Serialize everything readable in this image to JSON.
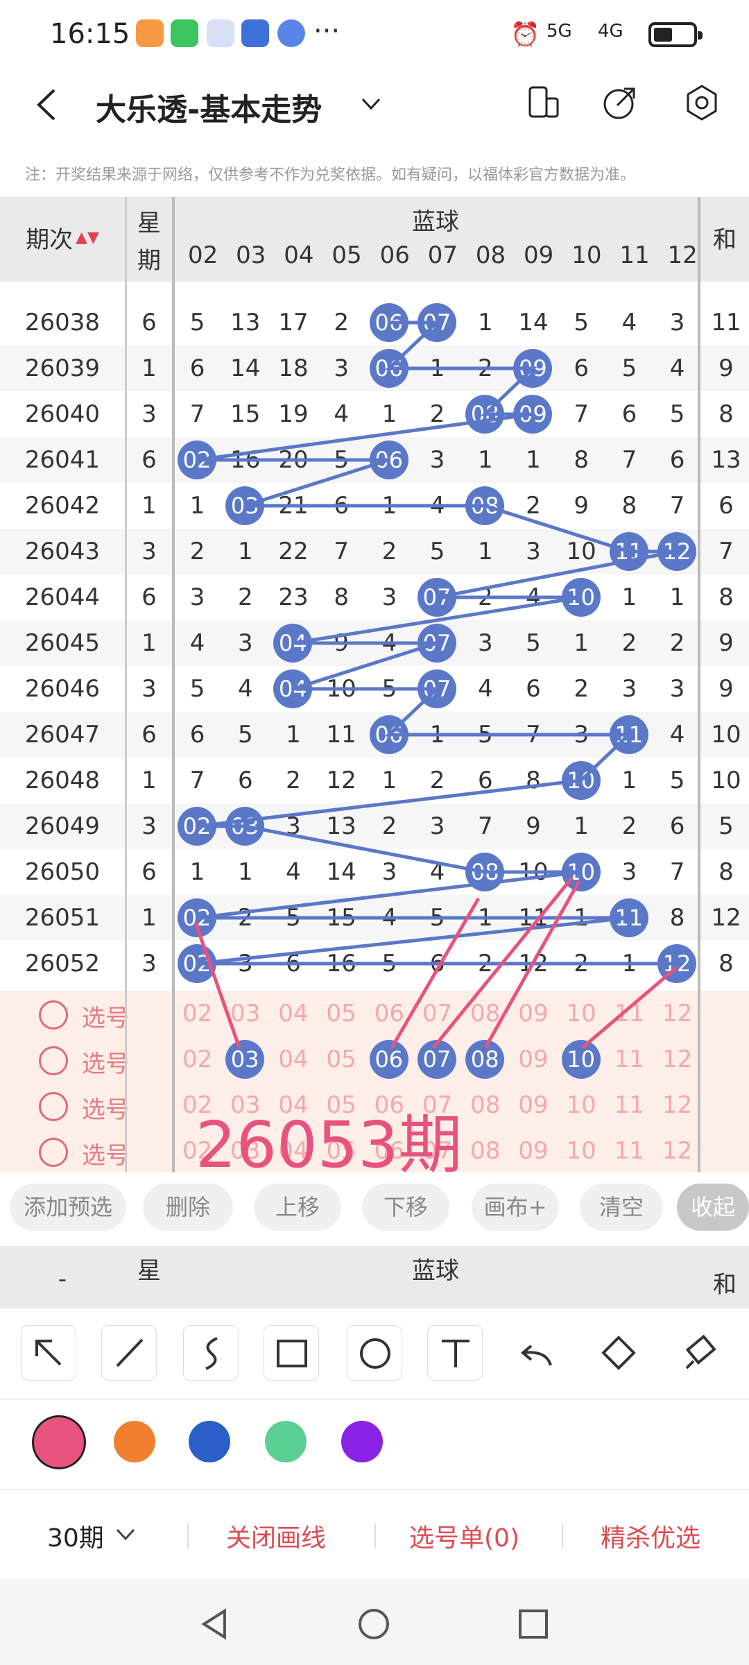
{
  "status_bar": {
    "time": "16:15",
    "signal_5g": "5G",
    "signal_4g": "4G",
    "more": "···"
  },
  "header": {
    "title": "大乐透-基本走势"
  },
  "note": "注：开奖结果来源于网络，仅供参考不作为兑奖依据。如有疑问，以福体彩官方数据为准。",
  "table": {
    "col_period": "期次",
    "col_week": "星期",
    "col_week_top": "星",
    "col_week_bottom": "期",
    "group_label": "蓝球",
    "col_sum": "和",
    "numbers": [
      "02",
      "03",
      "04",
      "05",
      "06",
      "07",
      "08",
      "09",
      "10",
      "11",
      "12"
    ],
    "rows": [
      {
        "period": "26038",
        "week": "6",
        "cells": [
          "5",
          "13",
          "17",
          "2",
          "06",
          "07",
          "1",
          "14",
          "5",
          "4",
          "3"
        ],
        "sum": "11",
        "hits": [
          4,
          5
        ]
      },
      {
        "period": "26039",
        "week": "1",
        "cells": [
          "6",
          "14",
          "18",
          "3",
          "06",
          "1",
          "2",
          "09",
          "6",
          "5",
          "4"
        ],
        "sum": "9",
        "hits": [
          4,
          7
        ]
      },
      {
        "period": "26040",
        "week": "3",
        "cells": [
          "7",
          "15",
          "19",
          "4",
          "1",
          "2",
          "08",
          "09",
          "7",
          "6",
          "5"
        ],
        "sum": "8",
        "hits": [
          6,
          7
        ]
      },
      {
        "period": "26041",
        "week": "6",
        "cells": [
          "02",
          "16",
          "20",
          "5",
          "06",
          "3",
          "1",
          "1",
          "8",
          "7",
          "6"
        ],
        "sum": "13",
        "hits": [
          0,
          4
        ]
      },
      {
        "period": "26042",
        "week": "1",
        "cells": [
          "1",
          "03",
          "21",
          "6",
          "1",
          "4",
          "08",
          "2",
          "9",
          "8",
          "7"
        ],
        "sum": "6",
        "hits": [
          1,
          6
        ]
      },
      {
        "period": "26043",
        "week": "3",
        "cells": [
          "2",
          "1",
          "22",
          "7",
          "2",
          "5",
          "1",
          "3",
          "10",
          "11",
          "12"
        ],
        "sum": "7",
        "hits": [
          9,
          10
        ]
      },
      {
        "period": "26044",
        "week": "6",
        "cells": [
          "3",
          "2",
          "23",
          "8",
          "3",
          "07",
          "2",
          "4",
          "10",
          "1",
          "1"
        ],
        "sum": "8",
        "hits": [
          5,
          8
        ]
      },
      {
        "period": "26045",
        "week": "1",
        "cells": [
          "4",
          "3",
          "04",
          "9",
          "4",
          "07",
          "3",
          "5",
          "1",
          "2",
          "2"
        ],
        "sum": "9",
        "hits": [
          2,
          5
        ]
      },
      {
        "period": "26046",
        "week": "3",
        "cells": [
          "5",
          "4",
          "04",
          "10",
          "5",
          "07",
          "4",
          "6",
          "2",
          "3",
          "3"
        ],
        "sum": "9",
        "hits": [
          2,
          5
        ]
      },
      {
        "period": "26047",
        "week": "6",
        "cells": [
          "6",
          "5",
          "1",
          "11",
          "06",
          "1",
          "5",
          "7",
          "3",
          "11",
          "4"
        ],
        "sum": "10",
        "hits": [
          4,
          9
        ]
      },
      {
        "period": "26048",
        "week": "1",
        "cells": [
          "7",
          "6",
          "2",
          "12",
          "1",
          "2",
          "6",
          "8",
          "10",
          "1",
          "5"
        ],
        "sum": "10",
        "hits": [
          8
        ]
      },
      {
        "period": "26049",
        "week": "3",
        "cells": [
          "02",
          "03",
          "3",
          "13",
          "2",
          "3",
          "7",
          "9",
          "1",
          "2",
          "6"
        ],
        "sum": "5",
        "hits": [
          0,
          1
        ]
      },
      {
        "period": "26050",
        "week": "6",
        "cells": [
          "1",
          "1",
          "4",
          "14",
          "3",
          "4",
          "08",
          "10",
          "10",
          "3",
          "7"
        ],
        "sum": "8",
        "hits": [
          6,
          8
        ]
      },
      {
        "period": "26051",
        "week": "1",
        "cells": [
          "02",
          "2",
          "5",
          "15",
          "4",
          "5",
          "1",
          "11",
          "1",
          "11",
          "8"
        ],
        "sum": "12",
        "hits": [
          0,
          9
        ]
      },
      {
        "period": "26052",
        "week": "3",
        "cells": [
          "02",
          "3",
          "6",
          "16",
          "5",
          "6",
          "2",
          "12",
          "2",
          "1",
          "12"
        ],
        "sum": "8",
        "hits": [
          0,
          10
        ]
      }
    ]
  },
  "selection": {
    "label": "选号",
    "rows": 4,
    "chosen": [
      "03",
      "06",
      "07",
      "08",
      "10"
    ],
    "annotation": "26053期"
  },
  "buttons": [
    "添加预选",
    "删除",
    "上移",
    "下移",
    "画布+",
    "清空",
    "收起"
  ],
  "colors": [
    "#e8527f",
    "#f08030",
    "#2a5fc9",
    "#5ccf93",
    "#8a22e6"
  ],
  "bottom": {
    "periods": "30期",
    "close_lines": "关闭画线",
    "pick_list": "选号单(0)",
    "optimize": "精杀优选"
  }
}
